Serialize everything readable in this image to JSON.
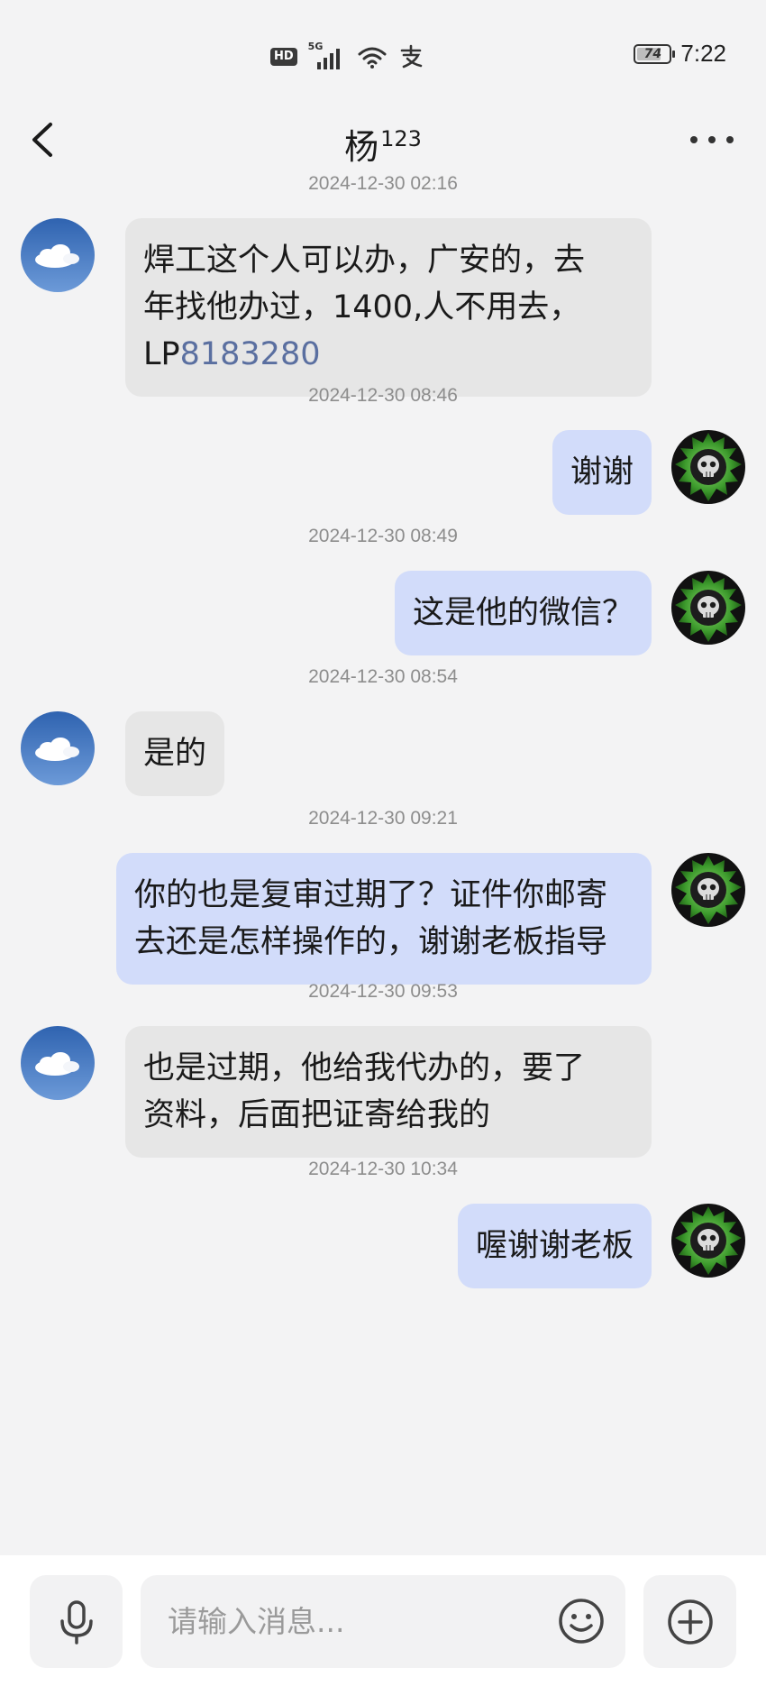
{
  "status_bar": {
    "hd": "HD",
    "network": "5G",
    "battery": "74",
    "battery_level_percent": 74,
    "time": "7:22",
    "icons": [
      "hd-icon",
      "signal-icon",
      "wifi-icon",
      "alipay-icon",
      "battery-icon"
    ]
  },
  "header": {
    "title": "杨",
    "title_sup": "123",
    "back_icon": "chevron-left-icon",
    "more_icon": "more-horizontal-icon"
  },
  "messages": [
    {
      "timestamp": "2024-12-30 02:16",
      "direction": "in",
      "lines": [
        "焊工这个人可以办，广安的，去",
        "年找他办过，1400,人不用去，"
      ],
      "lp_prefix": "LP",
      "lp_number": "8183280"
    },
    {
      "timestamp": "2024-12-30 08:46",
      "direction": "out",
      "text": "谢谢"
    },
    {
      "timestamp": "2024-12-30 08:49",
      "direction": "out",
      "text": "这是他的微信？"
    },
    {
      "timestamp": "2024-12-30 08:54",
      "direction": "in",
      "text": "是的"
    },
    {
      "timestamp": "2024-12-30 09:21",
      "direction": "out",
      "lines": [
        "你的也是复审过期了？证件你邮寄",
        "去还是怎样操作的，谢谢老板指导"
      ]
    },
    {
      "timestamp": "2024-12-30 09:53",
      "direction": "in",
      "lines": [
        "也是过期，他给我代办的，要了",
        "资料，后面把证寄给我的"
      ]
    },
    {
      "timestamp": "2024-12-30 10:34",
      "direction": "out",
      "text": "喔谢谢老板"
    }
  ],
  "input_bar": {
    "placeholder": "请输入消息...",
    "mic_icon": "microphone-icon",
    "emoji_icon": "smiley-icon",
    "plus_icon": "plus-circle-icon"
  },
  "colors": {
    "background": "#f3f3f4",
    "incoming_bubble": "#e6e6e6",
    "outgoing_bubble": "#d2dcfa",
    "link": "#5a6fa0",
    "timestamp": "#8d8d8d"
  }
}
